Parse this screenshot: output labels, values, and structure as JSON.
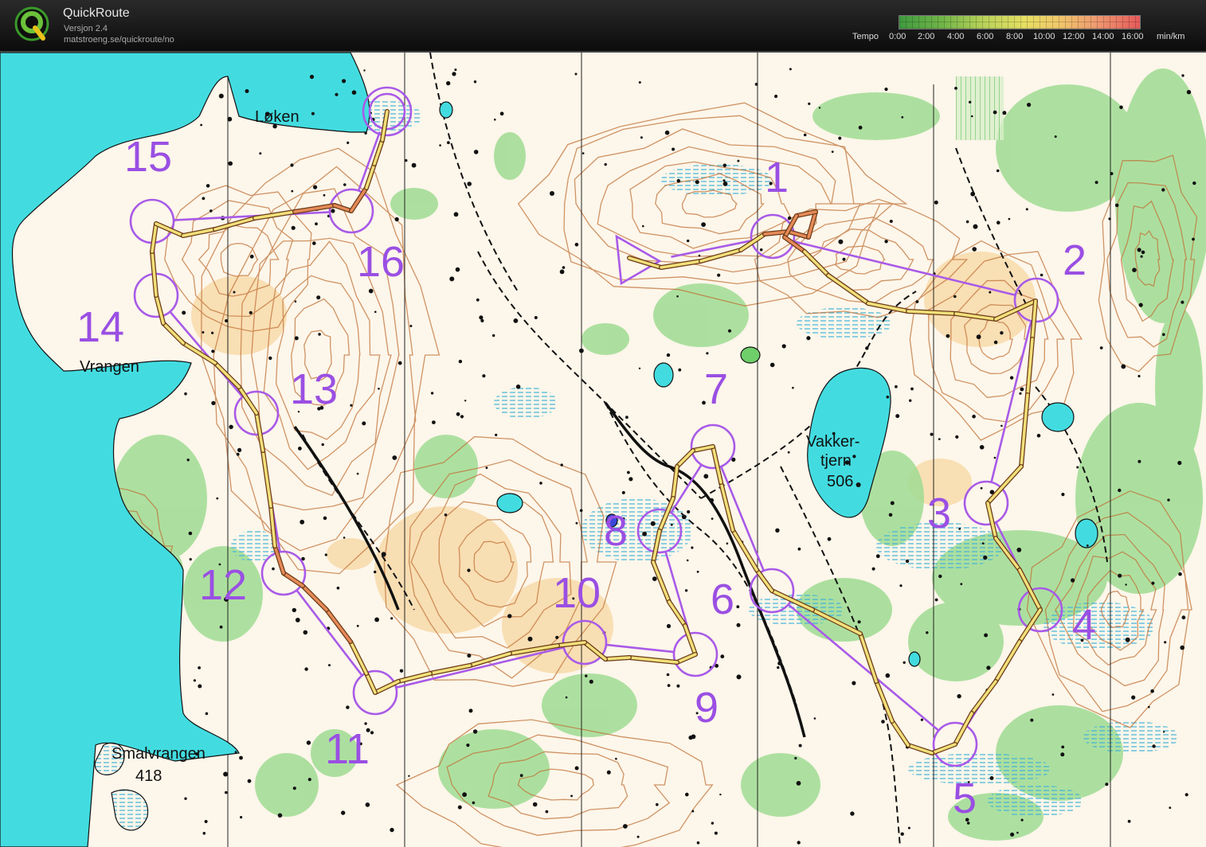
{
  "app": {
    "title": "QuickRoute",
    "version": "Versjon 2.4",
    "url": "matstroeng.se/quickroute/no"
  },
  "scale": {
    "label": "Tempo",
    "ticks": [
      "0:00",
      "2:00",
      "4:00",
      "6:00",
      "8:00",
      "10:00",
      "12:00",
      "14:00",
      "16:00"
    ],
    "unit": "min/km"
  },
  "map": {
    "place_names": {
      "loken": "Løken",
      "vrangen": "Vrangen",
      "vakkertjern_1": "Vakker-",
      "vakkertjern_2": "tjern",
      "vakkertjern_height": "506",
      "smalvrangen": "Smalvrangen",
      "smalvrangen_height": "418"
    },
    "controls": [
      {
        "number": "1"
      },
      {
        "number": "2"
      },
      {
        "number": "3"
      },
      {
        "number": "4"
      },
      {
        "number": "5"
      },
      {
        "number": "6"
      },
      {
        "number": "7"
      },
      {
        "number": "8"
      },
      {
        "number": "9"
      },
      {
        "number": "10"
      },
      {
        "number": "11"
      },
      {
        "number": "12"
      },
      {
        "number": "13"
      },
      {
        "number": "14"
      },
      {
        "number": "15"
      },
      {
        "number": "16"
      }
    ],
    "colors": {
      "course": "#a85ae8",
      "water": "#42dce0",
      "forest_green": "#8fd48a",
      "open_land": "#f4c98c",
      "contour": "#b8632a",
      "marsh": "#3fb3d8",
      "route_fast": "#f1e07a",
      "route_slow": "#e58a58"
    }
  }
}
